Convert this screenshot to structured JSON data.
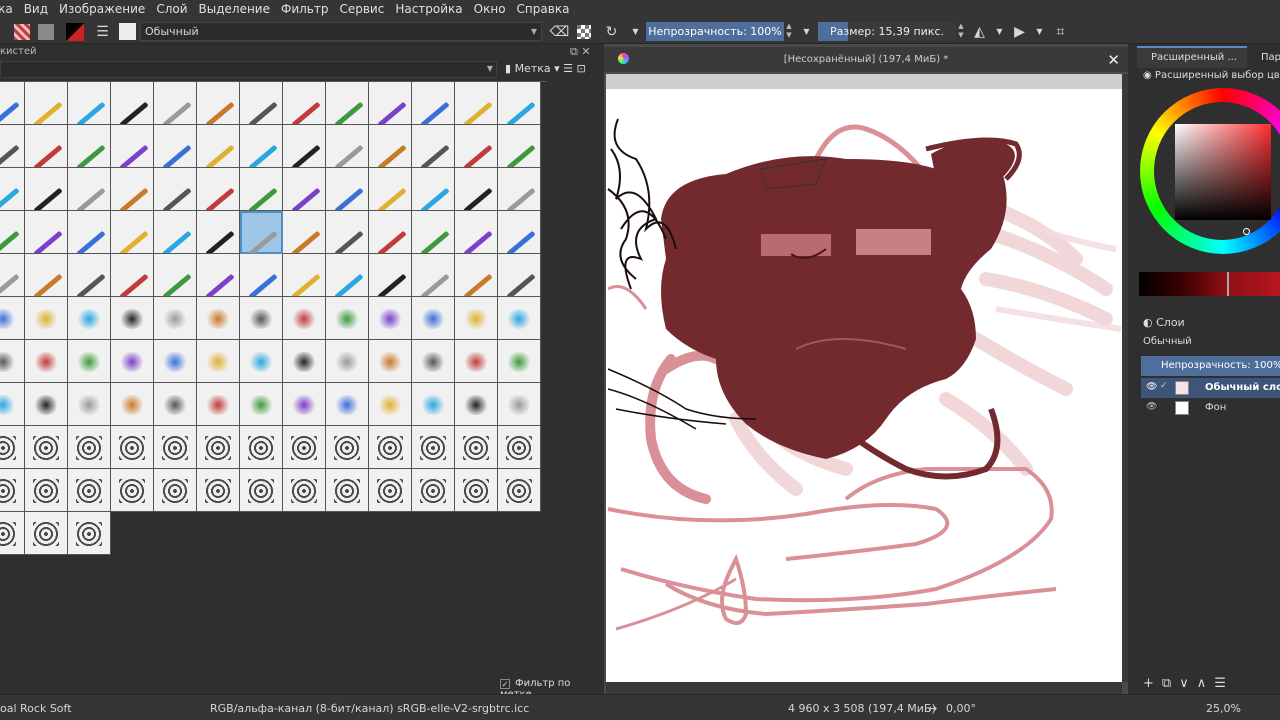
{
  "menu": [
    "вка",
    "Вид",
    "Изображение",
    "Слой",
    "Выделение",
    "Фильтр",
    "Сервис",
    "Настройка",
    "Окно",
    "Справка"
  ],
  "toolbar": {
    "blend_mode": "Обычный",
    "opacity_label": "Непрозрачность: 100%",
    "size_label": "Размер: 15,39 пикс."
  },
  "brush_docker": {
    "title": "кистей",
    "tag_label": "Метка",
    "filter_by_tag": "Фильтр по метке"
  },
  "canvas": {
    "title": "[Несохранённый] (197,4 МиБ) *"
  },
  "right_panel": {
    "tab_advanced": "Расширенный ...",
    "tab_params": "Парам",
    "advanced_color_selector": "Расширенный выбор цвета",
    "layers_title": "Слои",
    "layer_blend": "Обычный",
    "layer_opacity": "Непрозрачность:  100%",
    "layers": [
      {
        "name": "Обычный сло..."
      },
      {
        "name": "Фон"
      }
    ]
  },
  "statusbar": {
    "brush_name": "oal Rock Soft",
    "color_model": "RGB/альфа-канал (8-бит/канал)  sRGB-elle-V2-srgbtrc.icc",
    "image_size": "4 960 x 3 508 (197,4 МиБ)",
    "rotation": "0,00°",
    "zoom": "25,0%"
  },
  "colors": {
    "accent": "#4e6f9b",
    "paint_main": "#722a2e",
    "paint_pink": "#d99096"
  }
}
